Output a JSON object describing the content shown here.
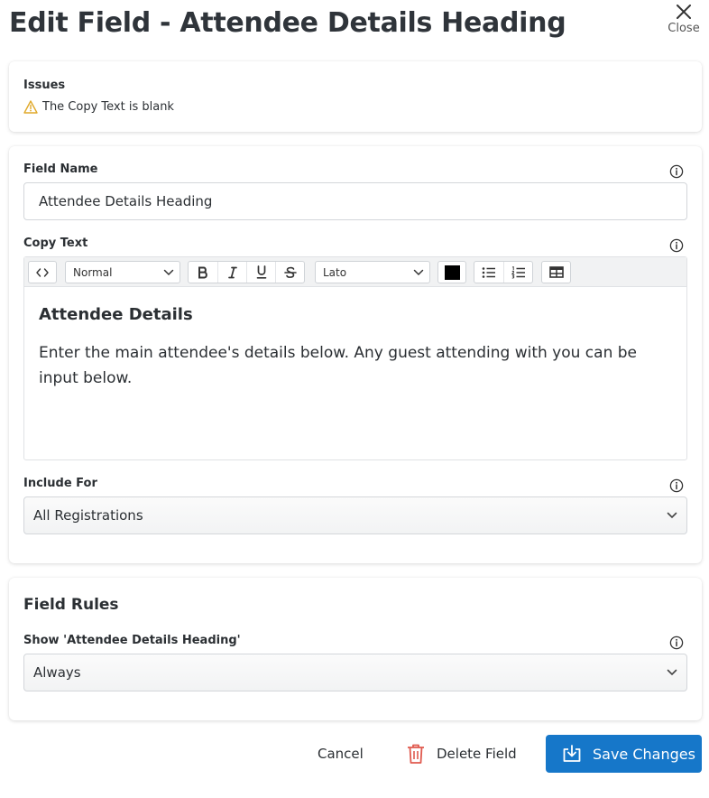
{
  "header": {
    "title": "Edit Field - Attendee Details Heading",
    "close_label": "Close"
  },
  "issues": {
    "label": "Issues",
    "items": [
      {
        "icon": "warning-icon",
        "text": "The Copy Text is blank"
      }
    ]
  },
  "field_name": {
    "label": "Field Name",
    "value": "Attendee Details Heading"
  },
  "copy_text": {
    "label": "Copy Text",
    "toolbar": {
      "format_select": "Normal",
      "font_select": "Lato",
      "color_swatch": "#000000"
    },
    "content": {
      "heading": "Attendee Details",
      "paragraph": "Enter the main attendee's details below. Any guest attending with you can be input below."
    }
  },
  "include_for": {
    "label": "Include For",
    "selected": "All Registrations"
  },
  "field_rules": {
    "title": "Field Rules",
    "show_label": "Show 'Attendee Details Heading'",
    "show_selected": "Always"
  },
  "footer": {
    "cancel_label": "Cancel",
    "delete_label": "Delete Field",
    "save_label": "Save Changes"
  },
  "colors": {
    "primary": "#1677c9",
    "warning": "#e0a92a",
    "danger": "#e05a4f"
  }
}
